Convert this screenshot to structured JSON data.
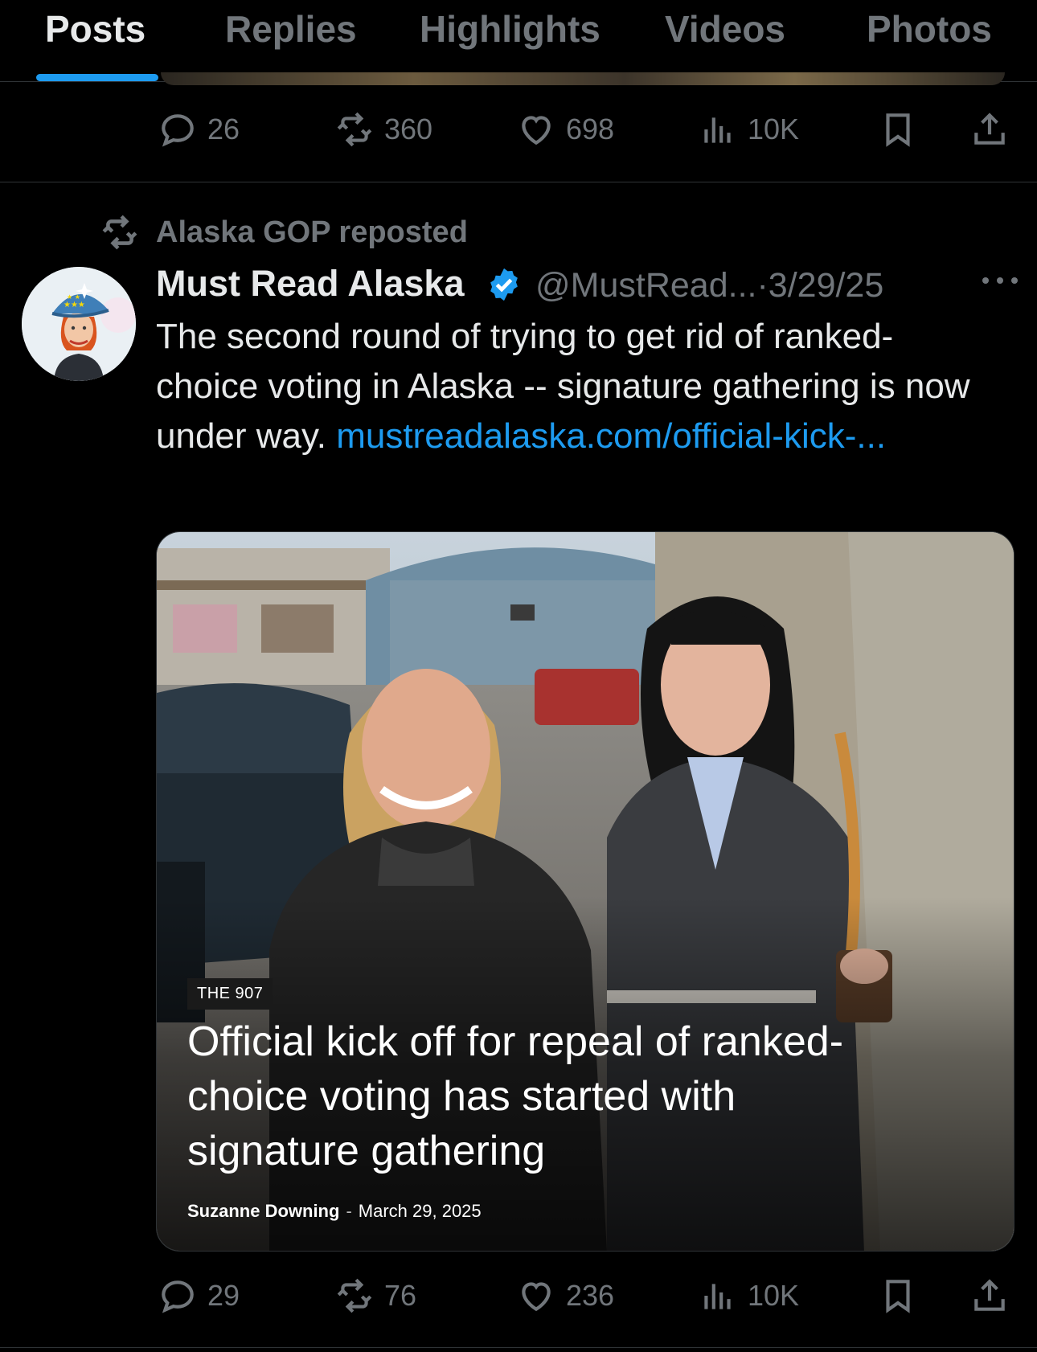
{
  "tabs": [
    {
      "label": "Posts",
      "active": true
    },
    {
      "label": "Replies",
      "active": false
    },
    {
      "label": "Highlights",
      "active": false
    },
    {
      "label": "Videos",
      "active": false
    },
    {
      "label": "Photos",
      "active": false
    }
  ],
  "accent_color": "#1d9bf0",
  "previous_post": {
    "replies": "26",
    "reposts": "360",
    "likes": "698",
    "views": "10K"
  },
  "post": {
    "repost_label": "Alaska GOP reposted",
    "author_name": "Must Read Alaska",
    "verified": true,
    "handle": "@MustRead...",
    "separator": "·",
    "date": "3/29/25",
    "text": "The second round of trying to get rid of ranked-choice voting in Alaska -- signature gathering is now under way. ",
    "link_text": "mustreadalaska.com/official-kick-...",
    "card": {
      "section": "THE 907",
      "headline": "Official kick off for repeal of ranked-choice voting has started with signature gathering",
      "author": "Suzanne Downing",
      "dash": "-",
      "date": "March 29, 2025"
    },
    "stats": {
      "replies": "29",
      "reposts": "76",
      "likes": "236",
      "views": "10K"
    }
  }
}
